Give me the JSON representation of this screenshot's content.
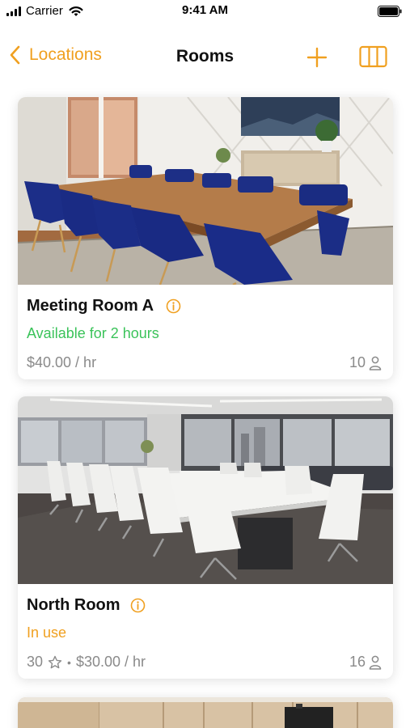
{
  "status_bar": {
    "carrier": "Carrier",
    "time": "9:41 AM"
  },
  "nav": {
    "back_label": "Locations",
    "title": "Rooms",
    "accent_color": "#f0a020"
  },
  "rooms": [
    {
      "name": "Meeting Room A",
      "status": "Available for 2 hours",
      "status_color": "#3bc35a",
      "price": "$40.00 / hr",
      "capacity": "10"
    },
    {
      "name": "North Room",
      "status": "In use",
      "status_color": "#f0a020",
      "rating": "30",
      "price": "$30.00 / hr",
      "capacity": "16"
    }
  ],
  "icons": [
    "signal-icon",
    "wifi-icon",
    "battery-icon",
    "chevron-left-icon",
    "plus-icon",
    "columns-icon",
    "info-icon",
    "person-icon",
    "star-icon"
  ]
}
